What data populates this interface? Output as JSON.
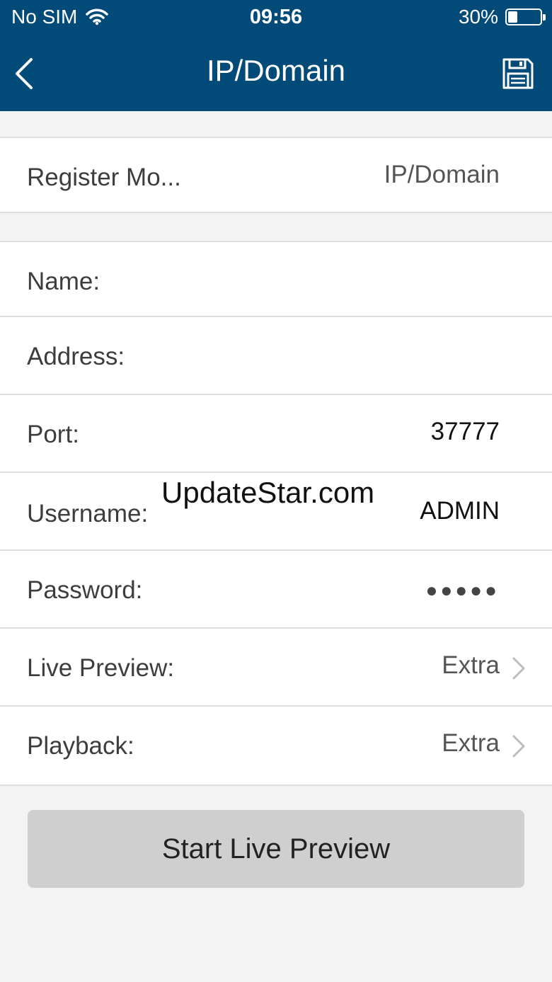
{
  "status_bar": {
    "carrier": "No SIM",
    "time": "09:56",
    "battery_percent_label": "30%",
    "battery_level": 0.3
  },
  "nav": {
    "title": "IP/Domain"
  },
  "register_mode": {
    "label": "Register Mo...",
    "value": "IP/Domain"
  },
  "fields": {
    "name_label": "Name:",
    "name_value": "",
    "address_label": "Address:",
    "address_value": "",
    "port_label": "Port:",
    "port_value": "37777",
    "username_label": "Username:",
    "username_value": "ADMIN",
    "password_label": "Password:",
    "password_value": "●●●●●",
    "live_preview_label": "Live Preview:",
    "live_preview_value": "Extra",
    "playback_label": "Playback:",
    "playback_value": "Extra"
  },
  "watermark": "UpdateStar.com",
  "start_button_label": "Start Live Preview",
  "colors": {
    "header": "#024a78",
    "background": "#f3f3f3",
    "button": "#cfcfcf"
  }
}
